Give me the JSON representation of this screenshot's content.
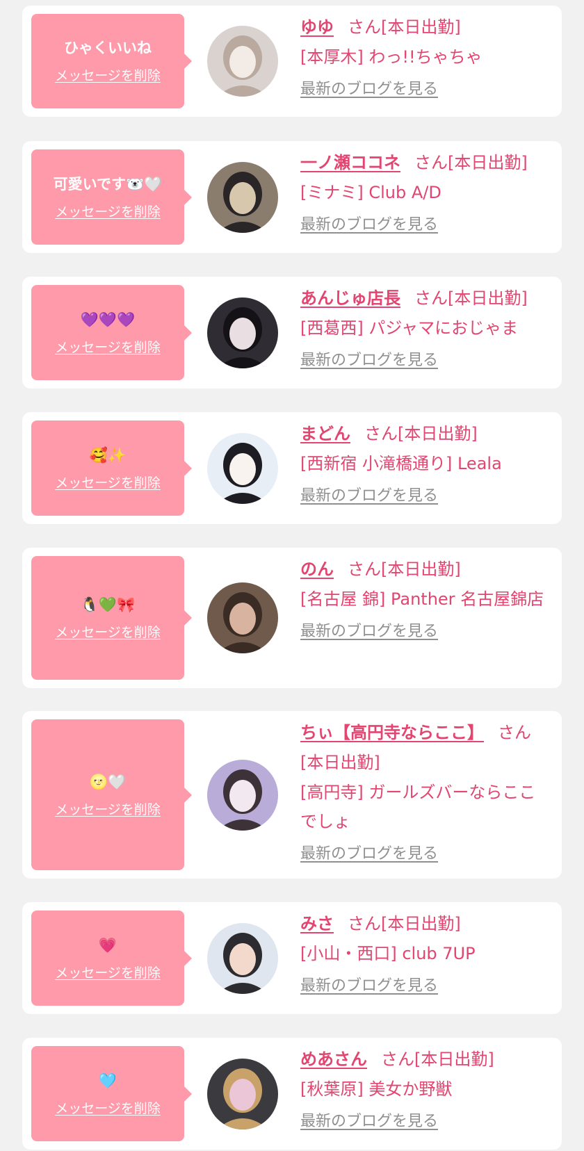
{
  "items": [
    {
      "message": "ひゃくいいね",
      "delete_label": "メッセージを削除",
      "name": "ゆゆ",
      "suffix": "さん[本日出勤]",
      "shop": "[本厚木] わっ!!ちゃちゃ",
      "blog_label": "最新のブログを見る",
      "avatar_colors": [
        "#d9d2cf",
        "#f3ece6",
        "#b9a99e"
      ]
    },
    {
      "message": "可愛いです🐻‍❄️🤍",
      "delete_label": "メッセージを削除",
      "name": "一ノ瀬ココネ",
      "suffix": "さん[本日出勤]",
      "shop": "[ミナミ] Club A/D",
      "blog_label": "最新のブログを見る",
      "avatar_colors": [
        "#8a7d6e",
        "#d7c7ad",
        "#2a2526"
      ]
    },
    {
      "message": "💜💜💜",
      "delete_label": "メッセージを削除",
      "name": "あんじゅ店長",
      "suffix": "さん[本日出勤]",
      "shop": "[西葛西] パジャマにおじゃま",
      "blog_label": "最新のブログを見る",
      "avatar_colors": [
        "#2f2c33",
        "#e9dfe3",
        "#141216"
      ]
    },
    {
      "message": "🥰✨",
      "delete_label": "メッセージを削除",
      "name": "まどん",
      "suffix": "さん[本日出勤]",
      "shop": "[西新宿 小滝橋通り] Leala",
      "blog_label": "最新のブログを見る",
      "avatar_colors": [
        "#e7eef6",
        "#f8f3ef",
        "#1c1c22"
      ]
    },
    {
      "message": "🐧💚🎀",
      "delete_label": "メッセージを削除",
      "name": "のん",
      "suffix": "さん[本日出勤]",
      "shop": "[名古屋 錦] Panther 名古屋錦店",
      "blog_label": "最新のブログを見る",
      "avatar_colors": [
        "#6f5a4c",
        "#d8b3a0",
        "#3a2c25"
      ]
    },
    {
      "message": "🌝🤍",
      "delete_label": "メッセージを削除",
      "name": "ちぃ【高円寺ならここ】",
      "suffix": "さん[本日出勤]",
      "shop": "[高円寺] ガールズバーならここでしょ",
      "blog_label": "最新のブログを見る",
      "avatar_colors": [
        "#b9acd8",
        "#f2e8ef",
        "#3d3238"
      ]
    },
    {
      "message": "💗",
      "delete_label": "メッセージを削除",
      "name": "みさ",
      "suffix": "さん[本日出勤]",
      "shop": "[小山・西口] club 7UP",
      "blog_label": "最新のブログを見る",
      "avatar_colors": [
        "#dfe6ef",
        "#f2d9cc",
        "#2b2b30"
      ]
    },
    {
      "message": "🩵",
      "delete_label": "メッセージを削除",
      "name": "めあさん",
      "suffix": "さん[本日出勤]",
      "shop": "[秋葉原] 美女か野獣",
      "blog_label": "最新のブログを見る",
      "avatar_colors": [
        "#3b3a3f",
        "#eac6d6",
        "#c9a26a"
      ]
    }
  ]
}
